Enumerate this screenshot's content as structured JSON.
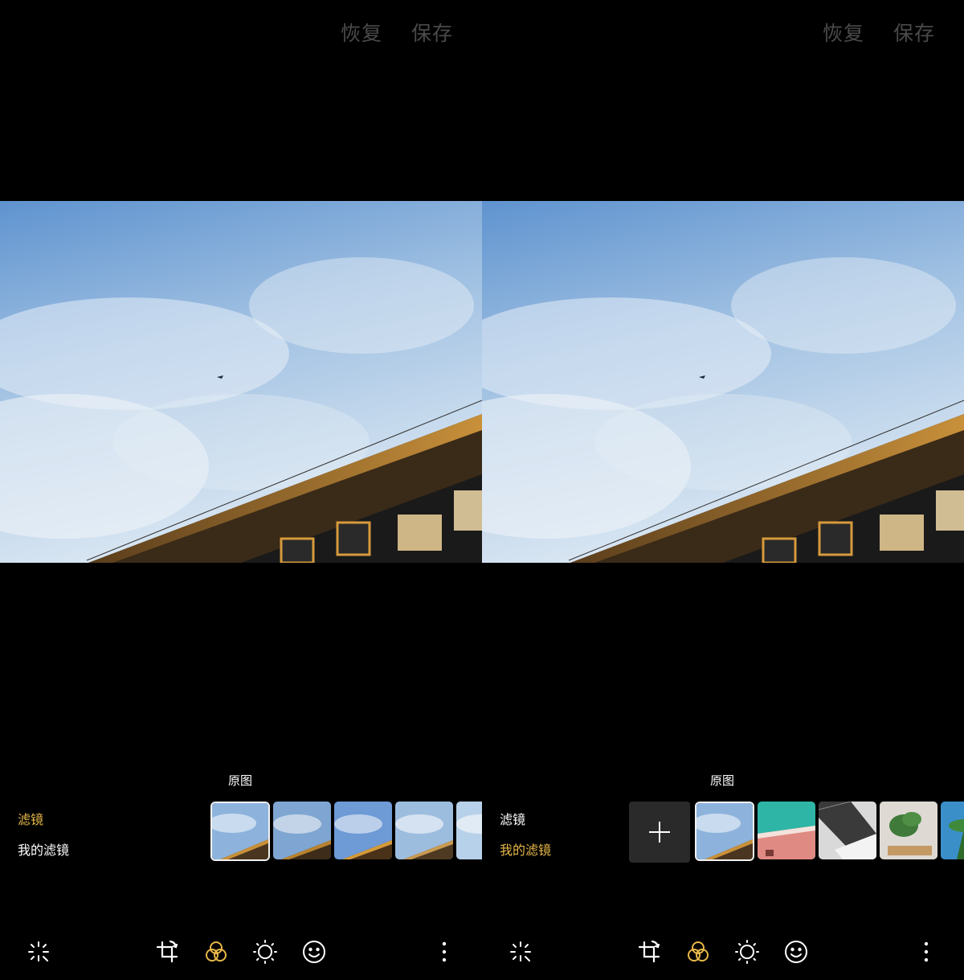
{
  "panels": [
    {
      "top_actions": {
        "restore_label": "恢复",
        "save_label": "保存"
      },
      "original_label": "原图",
      "categories": [
        {
          "label": "滤镜",
          "active": true
        },
        {
          "label": "我的滤镜",
          "active": false
        }
      ]
    },
    {
      "top_actions": {
        "restore_label": "恢复",
        "save_label": "保存"
      },
      "original_label": "原图",
      "categories": [
        {
          "label": "滤镜",
          "active": false
        },
        {
          "label": "我的滤镜",
          "active": true
        }
      ]
    }
  ],
  "toolbar_icons": [
    "magic-wand-icon",
    "crop-rotate-icon",
    "filter-icon",
    "brightness-icon",
    "smile-icon",
    "more-icon"
  ],
  "colors": {
    "accent": "#e8b84a",
    "inactive_text": "#ffffff",
    "top_action": "#4a4a4a",
    "background": "#000000"
  }
}
